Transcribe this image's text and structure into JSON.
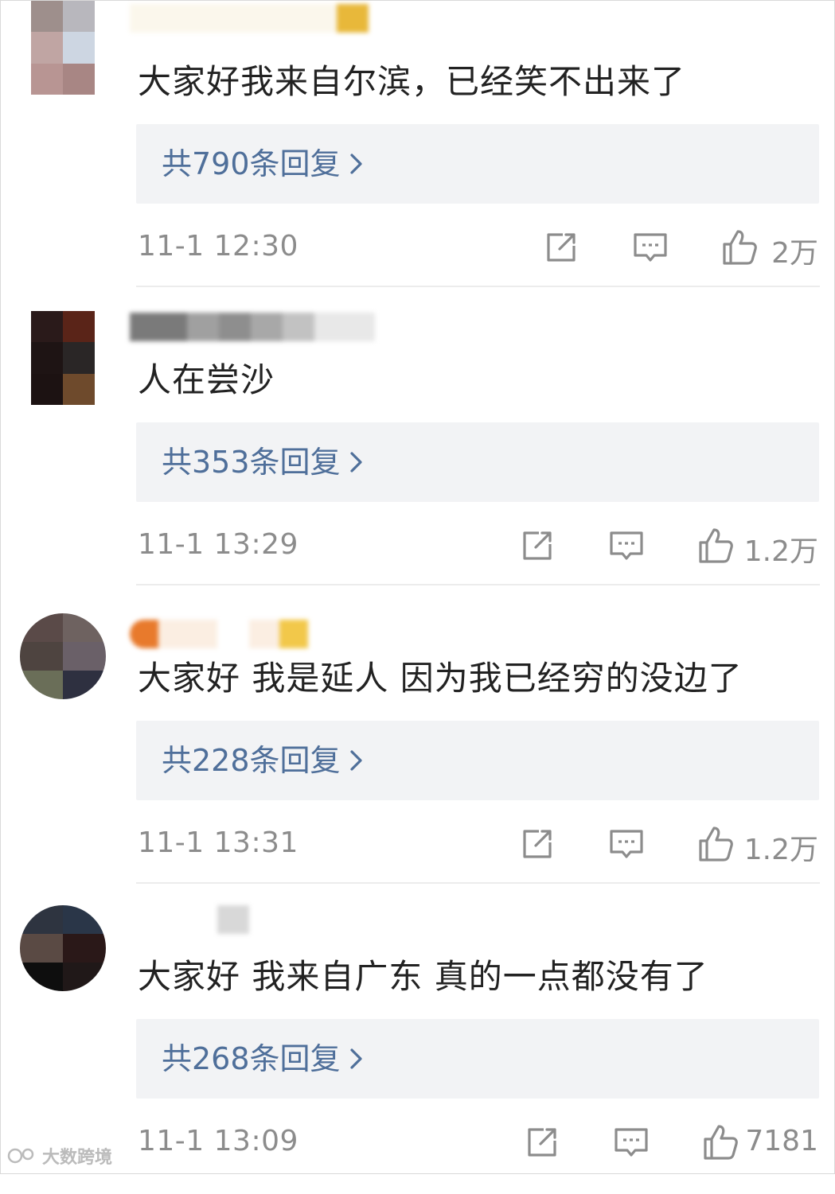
{
  "comments": [
    {
      "text": "大家好我来自尔滨，已经笑不出来了",
      "reply_label": "共790条回复",
      "time": "11-1 12:30",
      "likes": "2万"
    },
    {
      "text": "人在尝沙",
      "reply_label": "共353条回复",
      "time": "11-1 13:29",
      "likes": "1.2万"
    },
    {
      "text": "大家好 我是延人 因为我已经穷的没边了",
      "reply_label": "共228条回复",
      "time": "11-1 13:31",
      "likes": "1.2万"
    },
    {
      "text": "大家好 我来自广东 真的一点都没有了",
      "reply_label": "共268条回复",
      "time": "11-1 13:09",
      "likes": "7181"
    }
  ],
  "icons": {
    "share": "share-icon",
    "comment": "comment-icon",
    "like": "thumbs-up-icon",
    "reply_arrow": "chevron-right-icon"
  },
  "colors": {
    "reply_link": "#4f6f9a",
    "meta_text": "#8c8c8c",
    "reply_bg": "#f2f3f5"
  },
  "watermark": "大数跨境"
}
